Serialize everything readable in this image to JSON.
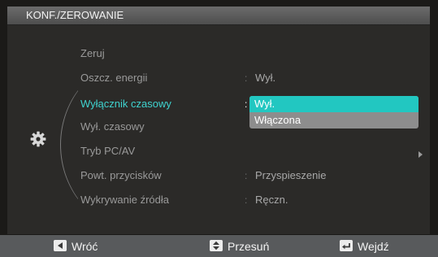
{
  "menu": {
    "title": "KONF./ZEROWANIE",
    "items": [
      {
        "label": "Zeruj",
        "value": ""
      },
      {
        "label": "Oszcz. energii",
        "value": "Wył."
      },
      {
        "label": "Wyłącznik czasowy",
        "value": ""
      },
      {
        "label": "Wył. czasowy",
        "value": ""
      },
      {
        "label": "Tryb PC/AV",
        "value": ""
      },
      {
        "label": "Powt. przycisków",
        "value": "Przyspieszenie"
      },
      {
        "label": "Wykrywanie źródła",
        "value": "Ręczn."
      }
    ],
    "selected_index": 2,
    "separator": ":"
  },
  "dropdown": {
    "options": [
      "Wył.",
      "Włączona"
    ],
    "highlighted_index": 0
  },
  "footer": {
    "back_label": "Wróć",
    "move_label": "Przesuń",
    "enter_label": "Wejdź"
  },
  "icons": {
    "category": "gear-icon",
    "back": "left-arrow-icon",
    "move": "up-down-arrow-icon",
    "enter": "enter-return-icon",
    "submenu": "chevron-right-icon"
  },
  "colors": {
    "accent": "#3fd3cf",
    "highlight": "#22c7c1",
    "panel": "#2b2a28",
    "footer": "#585a5c"
  }
}
